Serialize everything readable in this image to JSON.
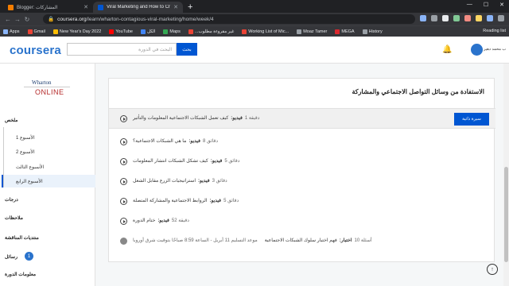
{
  "browser": {
    "tabs": [
      {
        "title": "Blogger: المشاركات",
        "favicon_color": "#f57d00"
      },
      {
        "title": "Viral Marketing and How to Craft...",
        "favicon_color": "#0056d2"
      }
    ],
    "url_host": "coursera.org",
    "url_path": "/learn/wharton-contagious-viral-marketing/home/week/4",
    "bookmarks": [
      "Apps",
      "Gmail",
      "New Year's Day 2022",
      "YouTube",
      "الكل",
      "Maps",
      "...غير مقروءة مطلوب",
      "Working List of Mic...",
      "Moaz Tamer",
      "MEGA",
      "History"
    ],
    "reading_list": "Reading list"
  },
  "header": {
    "logo": "coursera",
    "search_placeholder": "البحث في الدورة",
    "search_button": "بحث",
    "user_name": "ب محمد دهير"
  },
  "sidebar": {
    "brand_top": "Wharton",
    "brand_bottom": "ONLINE",
    "overview": "ملخص",
    "weeks": [
      "الأسبوع 1",
      "الأسبوع 2",
      "الأسبوع الثالث",
      "الأسبوع الرابع"
    ],
    "grades": "درجات",
    "notes": "ملاحظات",
    "forums": "منتديات المناقشة",
    "messages": "رسائل",
    "messages_count": "1",
    "info": "معلومات الدورة"
  },
  "lesson": {
    "title": "الاستفادة من وسائل التواصل الاجتماعي والمشاركة",
    "resume": "سيرة ذاتية",
    "items": [
      {
        "kind": "فيديو:",
        "text": "كيف تعمل الشبكات الاجتماعية المعلومات والتأثير",
        "duration": "دقيقة 1"
      },
      {
        "kind": "فيديو:",
        "text": "ما هي الشبكات الاجتماعية؟",
        "duration": "دقائق 8"
      },
      {
        "kind": "فيديو:",
        "text": "كيف تشكل الشبكات انتشار المعلومات",
        "duration": "دقائق 5"
      },
      {
        "kind": "فيديو:",
        "text": "استراتيجيات الزرع مقابل الشغل",
        "duration": "دقائق 3"
      },
      {
        "kind": "فيديو:",
        "text": "الروابط الاجتماعية والمشاركة المتصلة",
        "duration": "دقائق 5"
      },
      {
        "kind": "فيديو:",
        "text": "ختام الدورة",
        "duration": "دقيقة 52"
      },
      {
        "kind": "اختبار:",
        "text": "فهم اختبار سلوك الشبكات الاجتماعية",
        "duration": "أسئلة 10"
      }
    ],
    "due": "موعد التسليم 11 أبريل - الساعة 8:59 صباحًا بتوقيت شرق أوروبا"
  }
}
